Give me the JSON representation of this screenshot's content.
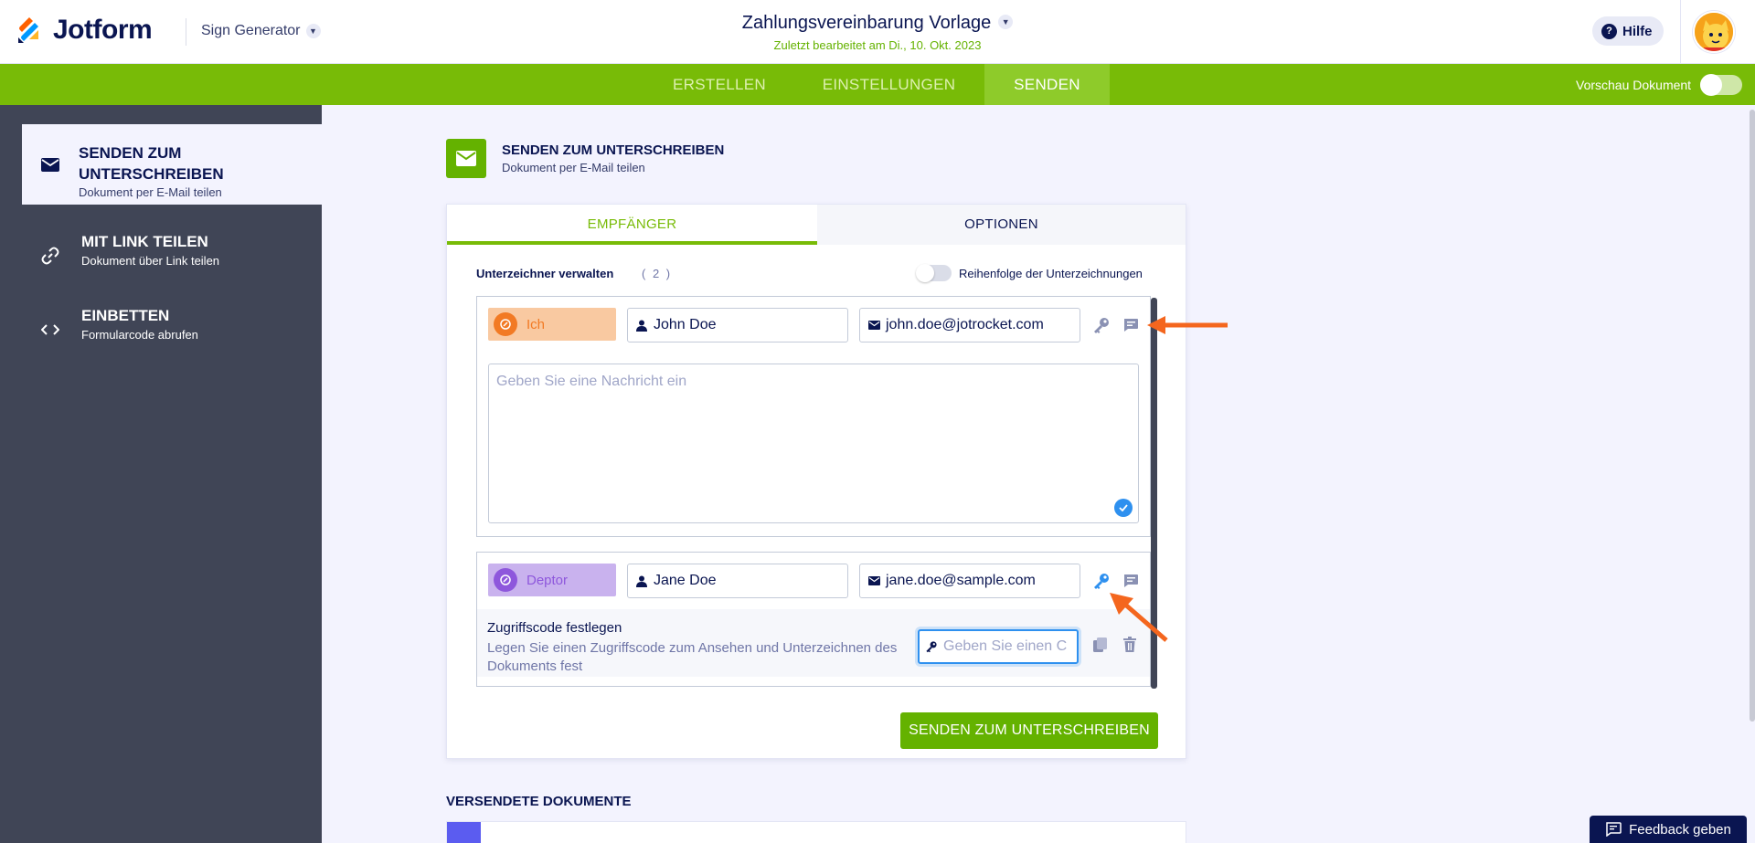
{
  "header": {
    "logo_text": "Jotform",
    "app_switcher": "Sign Generator",
    "doc_title": "Zahlungsvereinbarung Vorlage",
    "doc_subtitle": "Zuletzt bearbeitet am Di., 10. Okt. 2023",
    "help_label": "Hilfe"
  },
  "nav": {
    "tabs": [
      {
        "label": "ERSTELLEN"
      },
      {
        "label": "EINSTELLUNGEN"
      },
      {
        "label": "SENDEN",
        "active": true
      }
    ],
    "preview_label": "Vorschau Dokument",
    "preview_on": false
  },
  "sidebar": {
    "items": [
      {
        "title_line1": "SENDEN ZUM",
        "title_line2": "UNTERSCHREIBEN",
        "subtitle": "Dokument per E-Mail teilen",
        "icon": "envelope-icon",
        "active": true
      },
      {
        "title_line1": "MIT LINK TEILEN",
        "subtitle": "Dokument über Link teilen",
        "icon": "link-icon"
      },
      {
        "title_line1": "EINBETTEN",
        "subtitle": "Formularcode abrufen",
        "icon": "code-icon"
      }
    ]
  },
  "main": {
    "section_title": "SENDEN ZUM UNTERSCHREIBEN",
    "section_subtitle": "Dokument per E-Mail teilen",
    "tabs": [
      {
        "label": "EMPFÄNGER",
        "active": true
      },
      {
        "label": "OPTIONEN"
      }
    ],
    "manage_label": "Unterzeichner verwalten",
    "manage_count": "( 2 )",
    "order_label": "Reihenfolge der Unterzeichnungen",
    "order_on": false,
    "signers": [
      {
        "role": "Ich",
        "role_color": "#f9c9a1",
        "role_text_color": "#f27a24",
        "name": "John Doe",
        "email": "john.doe@jotrocket.com",
        "message_placeholder": "Geben Sie eine Nachricht ein"
      },
      {
        "role": "Deptor",
        "role_color": "#c9b2ee",
        "role_text_color": "#8e57dc",
        "name": "Jane Doe",
        "email": "jane.doe@sample.com",
        "access_code_title": "Zugriffscode festlegen",
        "access_code_desc": "Legen Sie einen Zugriffscode zum Ansehen und Unterzeichnen des Dokuments fest",
        "access_code_placeholder": "Geben Sie einen C"
      }
    ],
    "send_button": "SENDEN ZUM UNTERSCHREIBEN",
    "sent_title": "VERSENDETE DOKUMENTE"
  },
  "feedback_label": "Feedback geben",
  "colors": {
    "brand_green": "#78bb07",
    "button_green": "#64b200",
    "sidebar_bg": "#404556",
    "annotation_arrow": "#f4661e",
    "accent_blue": "#2e90ef"
  }
}
